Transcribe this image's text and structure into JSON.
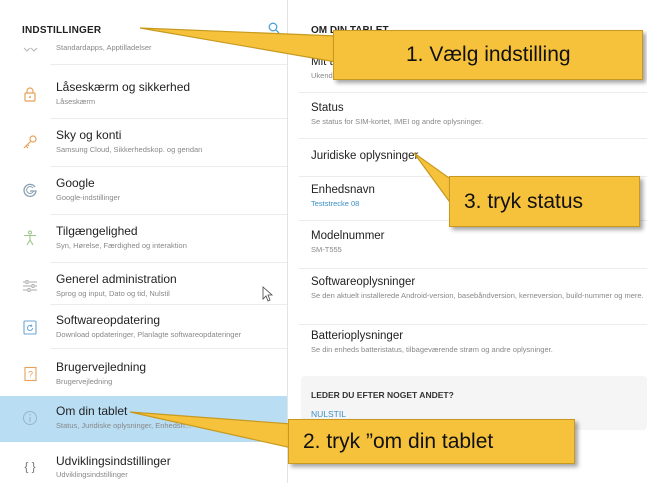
{
  "left": {
    "title": "INDSTILLINGER",
    "items": [
      {
        "title": "",
        "sub": "Standardapps, Apptilladelser",
        "icon": "apps-icon"
      },
      {
        "title": "Låseskærm og sikkerhed",
        "sub": "Låseskærm",
        "icon": "lock-icon"
      },
      {
        "title": "Sky og konti",
        "sub": "Samsung Cloud, Sikkerhedskop. og gendan",
        "icon": "key-icon"
      },
      {
        "title": "Google",
        "sub": "Google-indstillinger",
        "icon": "google-icon"
      },
      {
        "title": "Tilgængelighed",
        "sub": "Syn, Hørelse, Færdighed og interaktion",
        "icon": "accessibility-icon"
      },
      {
        "title": "Generel administration",
        "sub": "Sprog og input, Dato og tid, Nulstil",
        "icon": "sliders-icon"
      },
      {
        "title": "Softwareopdatering",
        "sub": "Download opdateringer, Planlagte softwareopdateringer",
        "icon": "update-icon"
      },
      {
        "title": "Brugervejledning",
        "sub": "Brugervejledning",
        "icon": "manual-icon"
      },
      {
        "title": "Om din tablet",
        "sub": "Status, Juridiske oplysninger, Enhedsn...",
        "icon": "info-icon"
      },
      {
        "title": "Udviklingsindstillinger",
        "sub": "Udviklingsindstillinger",
        "icon": "braces-icon"
      }
    ]
  },
  "right": {
    "title": "OM DIN TABLET",
    "items": [
      {
        "title": "Mit t...",
        "sub": "Ukend..."
      },
      {
        "title": "Status",
        "sub": "Se status for SIM-kortet, IMEI og andre oplysninger."
      },
      {
        "title": "Juridiske oplysninger",
        "sub": ""
      },
      {
        "title": "Enhedsnavn",
        "sub": "Teststrecke 08"
      },
      {
        "title": "Modelnummer",
        "sub": "SM-T555"
      },
      {
        "title": "Softwareoplysninger",
        "sub": "Se den aktuelt installerede Android-version, basebåndversion, kerneversion, build-nummer og mere."
      },
      {
        "title": "Batterioplysninger",
        "sub": "Se din enheds batteristatus, tilbageværende strøm og andre oplysninger."
      }
    ],
    "leder": {
      "title": "LEDER DU EFTER NOGET ANDET?",
      "link": "NULSTIL"
    }
  },
  "callouts": {
    "step1": "1.   Vælg indstilling",
    "step2": "2. tryk ”om din tablet",
    "step3": "3. tryk status"
  },
  "colors": {
    "selected_bg": "#b9ddf3",
    "accent_blue": "#3a8fc4",
    "callout_bg": "#f6c23b",
    "icon_orange": "#e8a15a"
  }
}
